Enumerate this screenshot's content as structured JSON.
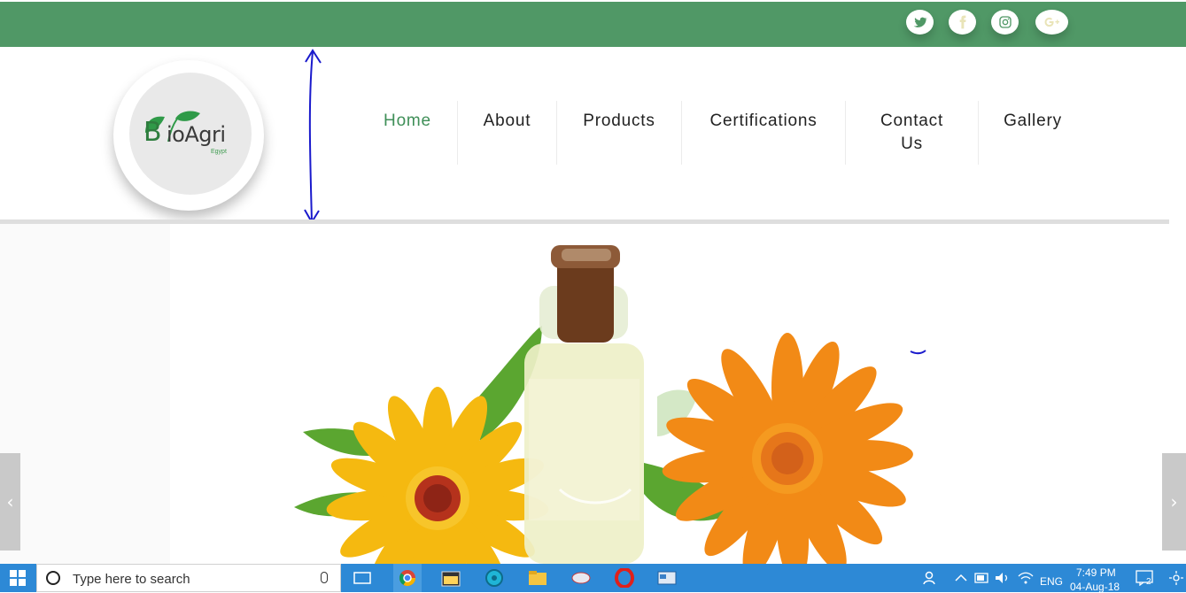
{
  "social": {
    "icons": [
      "twitter-icon",
      "facebook-icon",
      "instagram-icon",
      "google-plus-icon"
    ]
  },
  "logo": {
    "name": "ioAgri",
    "initial": "B",
    "subtitle": "Egypt"
  },
  "nav": {
    "items": [
      {
        "label": "Home",
        "active": true
      },
      {
        "label": "About",
        "active": false
      },
      {
        "label": "Products",
        "active": false
      },
      {
        "label": "Certifications",
        "active": false
      },
      {
        "label": "Contact Us",
        "active": false
      },
      {
        "label": "Gallery",
        "active": false
      }
    ]
  },
  "slider": {
    "prev_label": "‹",
    "next_label": "›"
  },
  "taskbar": {
    "search_placeholder": "Type here to search",
    "language": "ENG",
    "time": "7:49 PM",
    "date": "04-Aug-18",
    "notification_count": "2"
  },
  "colors": {
    "topbar": "#509866",
    "nav_active": "#3f8f58",
    "taskbar": "#2d89d6",
    "annotation": "#1a1acc"
  }
}
